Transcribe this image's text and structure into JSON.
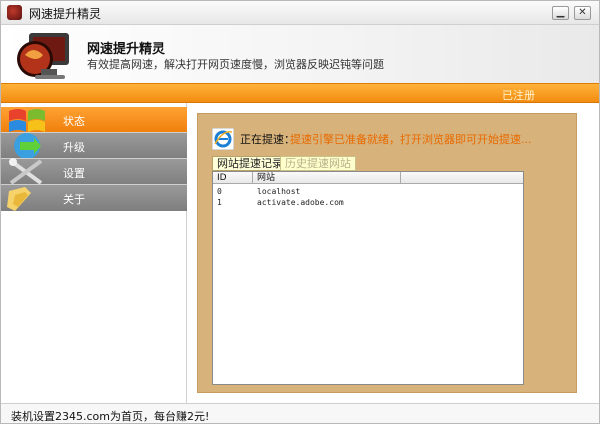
{
  "window": {
    "title": "网速提升精灵",
    "minimize_icon": "minimize-icon",
    "close_icon": "close-icon"
  },
  "header": {
    "app_name": "网速提升精灵",
    "tagline": "有效提高网速，解决打开网页速度慢，浏览器反映迟钝等问题",
    "registered": "已注册"
  },
  "sidebar": {
    "items": [
      {
        "label": "状态",
        "icon": "windows-flag-icon",
        "active": true
      },
      {
        "label": "升级",
        "icon": "upgrade-arrow-icon",
        "active": false
      },
      {
        "label": "设置",
        "icon": "tools-icon",
        "active": false
      },
      {
        "label": "关于",
        "icon": "info-folder-icon",
        "active": false
      }
    ]
  },
  "main": {
    "status_label": "正在提速：",
    "status_message": "提速引擎已准备就绪，打开浏览器即可开始提速...",
    "tabs": [
      {
        "label": "网站提速记录",
        "active": true
      },
      {
        "label": "历史提速网站",
        "active": false
      }
    ],
    "table": {
      "columns": [
        "ID",
        "网站"
      ],
      "rows": [
        {
          "id": "0",
          "site": "localhost"
        },
        {
          "id": "1",
          "site": "activate.adobe.com"
        }
      ]
    }
  },
  "statusbar": {
    "text": "装机设置2345.com为首页，每台赚2元!"
  },
  "colors": {
    "accent_orange": "#f28c10",
    "panel_tan": "#d7b27a",
    "nav_gray": "#8a8a8a",
    "message_orange": "#e86a00"
  }
}
